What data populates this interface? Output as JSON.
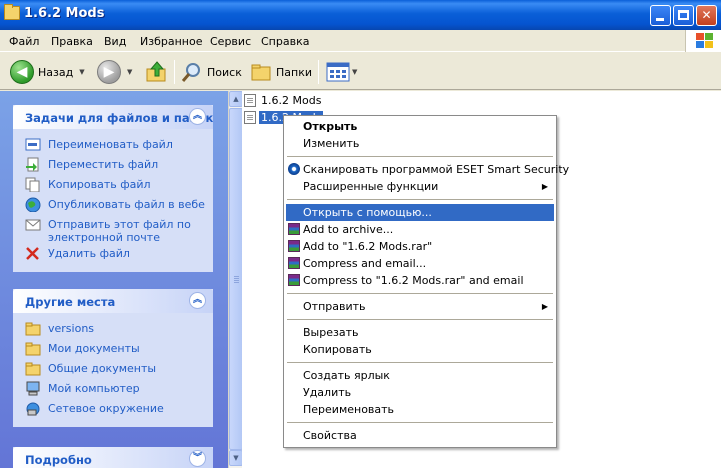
{
  "window": {
    "title": "1.6.2 Mods"
  },
  "menubar": {
    "items": [
      "Файл",
      "Правка",
      "Вид",
      "Избранное",
      "Сервис",
      "Справка"
    ]
  },
  "toolbar": {
    "back_label": "Назад",
    "search_label": "Поиск",
    "folders_label": "Папки"
  },
  "tasks_panel": {
    "title": "Задачи для файлов и папок",
    "items": [
      {
        "label": "Переименовать файл",
        "icon": "rename-icon"
      },
      {
        "label": "Переместить файл",
        "icon": "move-icon"
      },
      {
        "label": "Копировать файл",
        "icon": "copy-icon"
      },
      {
        "label": "Опубликовать файл в вебе",
        "icon": "web-publish-icon"
      },
      {
        "label": "Отправить этот файл по электронной почте",
        "icon": "email-icon"
      },
      {
        "label": "Удалить файл",
        "icon": "delete-icon"
      }
    ]
  },
  "places_panel": {
    "title": "Другие места",
    "items": [
      {
        "label": "versions",
        "icon": "folder-icon"
      },
      {
        "label": "Мои документы",
        "icon": "folder-icon"
      },
      {
        "label": "Общие документы",
        "icon": "folder-icon"
      },
      {
        "label": "Мой компьютер",
        "icon": "computer-icon"
      },
      {
        "label": "Сетевое окружение",
        "icon": "network-icon"
      }
    ]
  },
  "details_panel": {
    "title": "Подробно"
  },
  "files": [
    {
      "name": "1.6.2 Mods",
      "selected": false
    },
    {
      "name": "1.6.2 Mods",
      "selected": true
    }
  ],
  "context_menu": {
    "open": "Открыть",
    "edit": "Изменить",
    "eset_scan": "Сканировать программой ESET Smart Security",
    "advanced": "Расширенные функции",
    "open_with": "Открыть с помощью...",
    "add_archive": "Add to archive...",
    "add_rar": "Add to \"1.6.2 Mods.rar\"",
    "compress_email": "Compress and email...",
    "compress_rar_email": "Compress to \"1.6.2 Mods.rar\" and email",
    "send_to": "Отправить",
    "cut": "Вырезать",
    "copy": "Копировать",
    "create_shortcut": "Создать ярлык",
    "delete": "Удалить",
    "rename": "Переименовать",
    "properties": "Свойства"
  },
  "colors": {
    "titlebar": "#0A5FD8",
    "selection": "#316AC5",
    "panel_text": "#215DC6"
  }
}
